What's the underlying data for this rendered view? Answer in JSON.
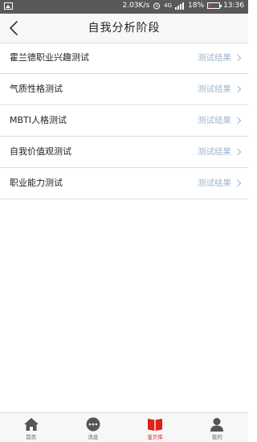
{
  "status_bar": {
    "speed": "2.03K/s",
    "network": "4G",
    "battery_percent": "18%",
    "battery_level": 0.18,
    "time": "13:36"
  },
  "header": {
    "title": "自我分析阶段"
  },
  "list": [
    {
      "label": "霍兰德职业兴趣测试",
      "action": "测试结果"
    },
    {
      "label": "气质性格测试",
      "action": "测试结果"
    },
    {
      "label": "MBTI人格测试",
      "action": "测试结果"
    },
    {
      "label": "自我价值观测试",
      "action": "测试结果"
    },
    {
      "label": "职业能力测试",
      "action": "测试结果"
    }
  ],
  "bottom_nav": [
    {
      "label": "首页",
      "icon": "home-icon"
    },
    {
      "label": "消息",
      "icon": "message-icon"
    },
    {
      "label": "宝贝库",
      "icon": "book-icon",
      "active": true
    },
    {
      "label": "我的",
      "icon": "user-icon"
    }
  ],
  "colors": {
    "accent": "#e0201a",
    "link": "#9fb3cc",
    "status_bar": "#595959"
  }
}
